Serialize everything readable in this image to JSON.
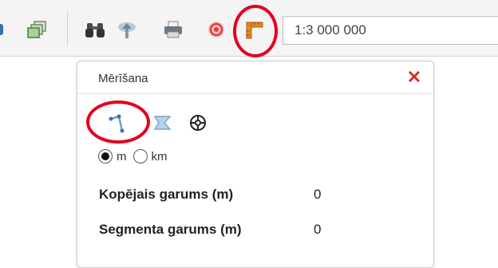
{
  "toolbar": {
    "scale_value": "1:3 000 000",
    "buttons": [
      {
        "name": "layers-icon"
      },
      {
        "name": "binoculars-icon"
      },
      {
        "name": "pan-icon"
      },
      {
        "name": "print-icon"
      },
      {
        "name": "target-icon"
      },
      {
        "name": "measure-ruler-icon"
      }
    ]
  },
  "panel": {
    "title": "Mērīšana",
    "tools": [
      {
        "name": "measure-line-icon"
      },
      {
        "name": "measure-area-icon"
      },
      {
        "name": "measure-point-icon"
      }
    ],
    "units": [
      {
        "label": "m",
        "checked": true
      },
      {
        "label": "km",
        "checked": false
      }
    ],
    "total_length_label": "Kopējais garums (m)",
    "total_length_value": "0",
    "segment_length_label": "Segmenta garums (m)",
    "segment_length_value": "0"
  },
  "colors": {
    "highlight_ring": "#e4001b",
    "close_icon": "#d7281e",
    "ruler_icon": "#e58a1f",
    "target_icon": "#e23b3b"
  }
}
